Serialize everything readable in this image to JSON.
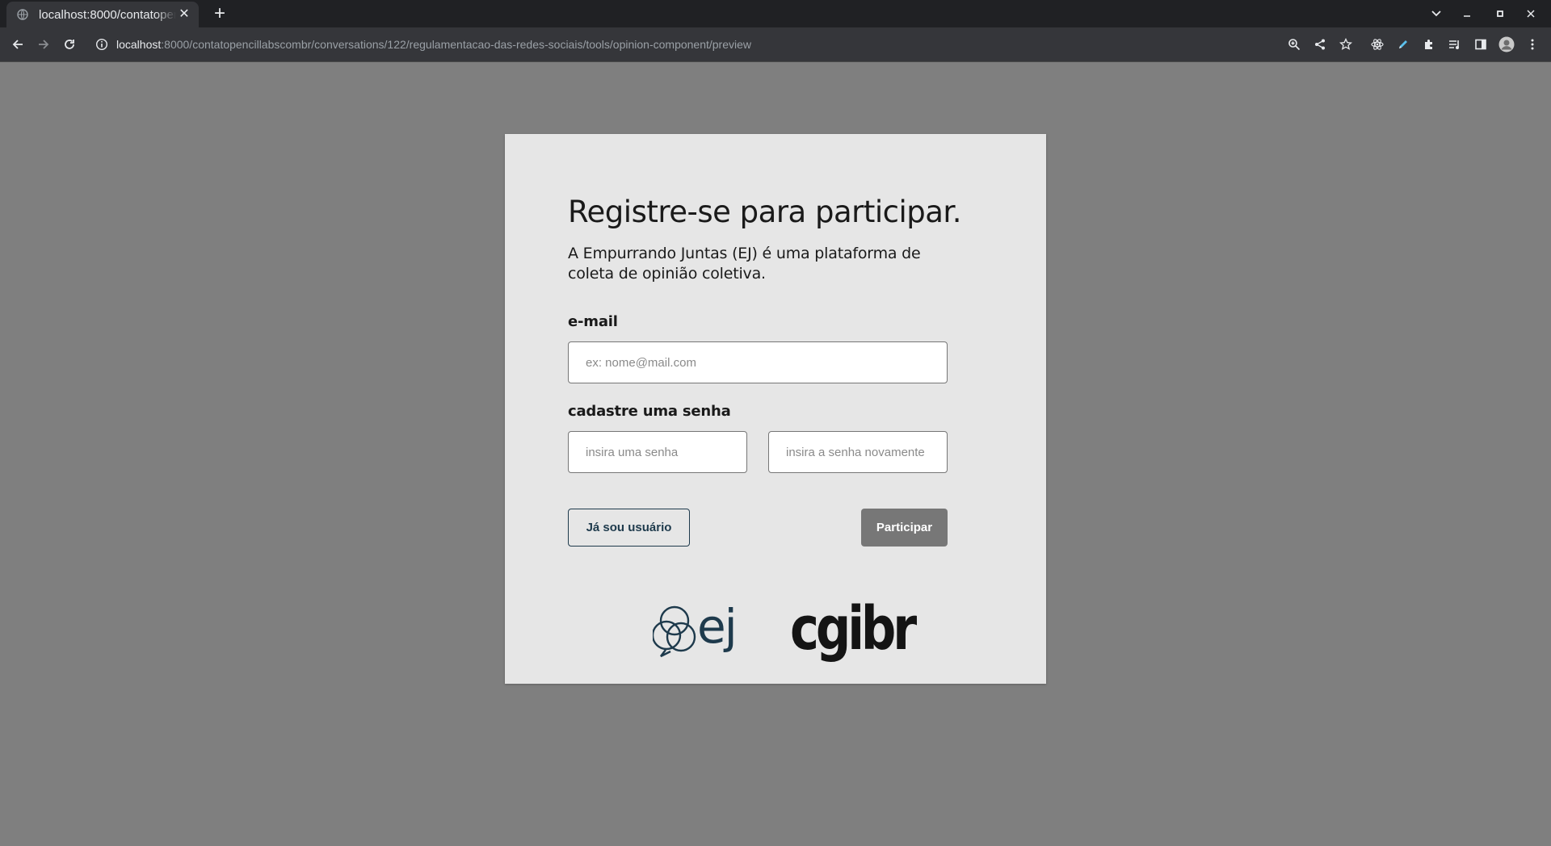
{
  "browser": {
    "tab": {
      "title": "localhost:8000/contatopencillabscombr/conversations/122/regulamentacao-das-redes-sociais/tools/opinion-component/preview"
    },
    "address": {
      "host": "localhost",
      "rest": ":8000/contatopencillabscombr/conversations/122/regulamentacao-das-redes-sociais/tools/opinion-component/preview"
    }
  },
  "form": {
    "headline": "Registre-se para participar.",
    "subtitle": "A Empurrando Juntas (EJ) é uma plataforma de coleta de opinião coletiva.",
    "email_label": "e-mail",
    "email_placeholder": "ex: nome@mail.com",
    "password_label": "cadastre uma senha",
    "password_placeholder": "insira uma senha",
    "password_confirm_placeholder": "insira a senha novamente",
    "login_button": "Já sou usuário",
    "submit_button": "Participar"
  },
  "logos": {
    "ej_text": "ej",
    "cgi_text": "cgibr"
  },
  "colors": {
    "page_background": "#7f7f7f",
    "card_background": "#e6e6e6",
    "brand_navy": "#1e3a4c",
    "submit_disabled": "#777777"
  }
}
